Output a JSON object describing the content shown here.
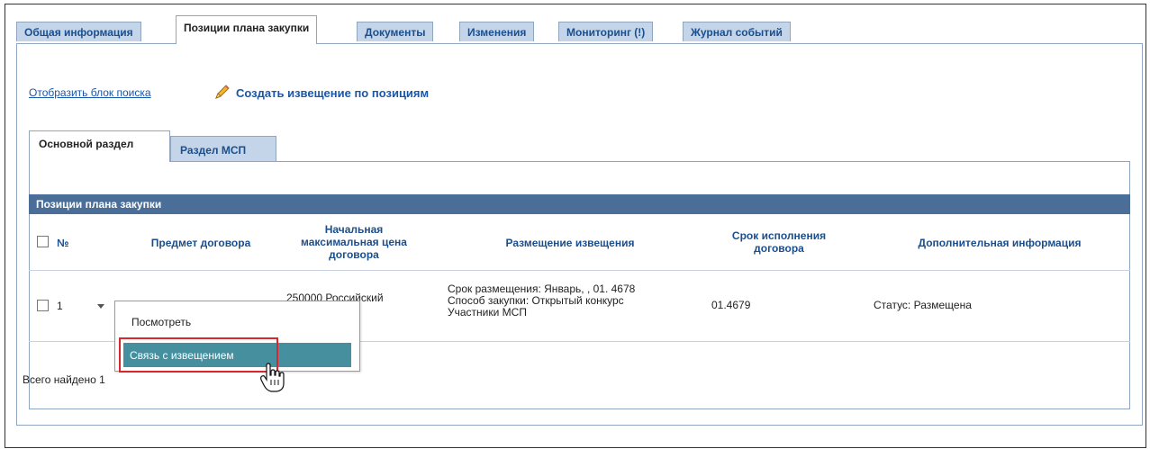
{
  "tabs": [
    {
      "label": "Общая информация",
      "active": false
    },
    {
      "label": "Позиции плана закупки",
      "active": true
    },
    {
      "label": "Документы",
      "active": false
    },
    {
      "label": "Изменения",
      "active": false
    },
    {
      "label": "Мониторинг (!)",
      "active": false
    },
    {
      "label": "Журнал событий",
      "active": false
    }
  ],
  "actions": {
    "search_link": "Отобразить блок поиска",
    "create_notice": "Создать извещение по позициям",
    "create_icon": "pencil-icon"
  },
  "subtabs": [
    {
      "label": "Основной раздел",
      "active": true
    },
    {
      "label": "Раздел МСП",
      "active": false
    }
  ],
  "table": {
    "title": "Позиции плана закупки",
    "columns": {
      "number": "№",
      "subject": "Предмет договора",
      "price_l1": "Начальная",
      "price_l2": "максимальная цена",
      "price_l3": "договора",
      "placement": "Размещение извещения",
      "term_l1": "Срок исполнения",
      "term_l2": "договора",
      "info": "Дополнительная информация"
    },
    "rows": [
      {
        "number": "1",
        "price": "250000 Российский",
        "placement_l1": "Срок размещения: Январь, , 01. 4678",
        "placement_l2": "Способ закупки: Открытый конкурс",
        "placement_l3": "Участники МСП",
        "term": "01.4679",
        "info": "Статус: Размещена"
      }
    ]
  },
  "context_menu": {
    "items": [
      "Посмотреть",
      "Связь с извещением"
    ],
    "highlighted": "Связь с извещением"
  },
  "footer": {
    "total_found": "Всего найдено 1"
  },
  "colors": {
    "tab_bg": "#c4d5ea",
    "header_bar": "#4a6e98",
    "menu_highlight": "#458f9e",
    "annotation_red": "#d9272e",
    "link": "#1a56a8"
  }
}
